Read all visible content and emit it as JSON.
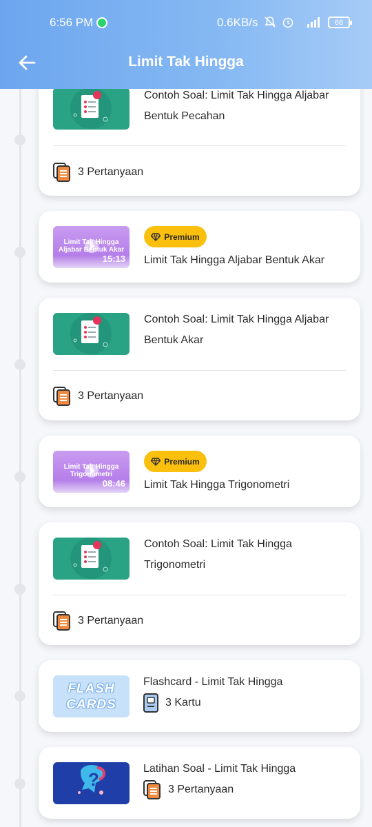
{
  "status_bar": {
    "time": "6:56 PM",
    "network_speed": "0.6KB/s",
    "network_type": "4G+",
    "battery": "68",
    "icons": [
      "whatsapp-icon",
      "mute-icon",
      "alarm-icon",
      "signal-icon",
      "battery-icon"
    ]
  },
  "appbar": {
    "title": "Limit Tak Hingga",
    "back_icon": "arrow-left-icon"
  },
  "colors": {
    "header_gradient_start": "#6da6ef",
    "header_gradient_end": "#a6cbf6",
    "premium_badge": "#fbbf0e",
    "quiz_thumb": "#2aa385",
    "latihan_thumb": "#1f3ea8"
  },
  "items": [
    {
      "type": "practice",
      "title": "Contoh Soal: Limit Tak Hingga Aljabar Bentuk Pecahan",
      "meta": "3 Pertanyaan"
    },
    {
      "type": "video",
      "badge": "Premium",
      "title": "Limit Tak Hingga Aljabar Bentuk Akar",
      "thumb_title": "Limit Tak Hingga Aljabar Bentuk Akar",
      "duration": "15:13"
    },
    {
      "type": "practice",
      "title": "Contoh Soal: Limit Tak Hingga Aljabar Bentuk Akar",
      "meta": "3 Pertanyaan"
    },
    {
      "type": "video",
      "badge": "Premium",
      "title": "Limit Tak Hingga Trigonometri",
      "thumb_title": "Limit Tak Hingga Trigonometri",
      "duration": "08:46"
    },
    {
      "type": "practice",
      "title": "Contoh Soal: Limit Tak Hingga Trigonometri",
      "meta": "3 Pertanyaan"
    },
    {
      "type": "flashcard",
      "title": "Flashcard - Limit Tak Hingga",
      "thumb_text": "FLASH CARDS",
      "meta": "3 Kartu"
    },
    {
      "type": "exercise",
      "title": "Latihan Soal - Limit Tak Hingga",
      "meta": "3 Pertanyaan"
    }
  ]
}
